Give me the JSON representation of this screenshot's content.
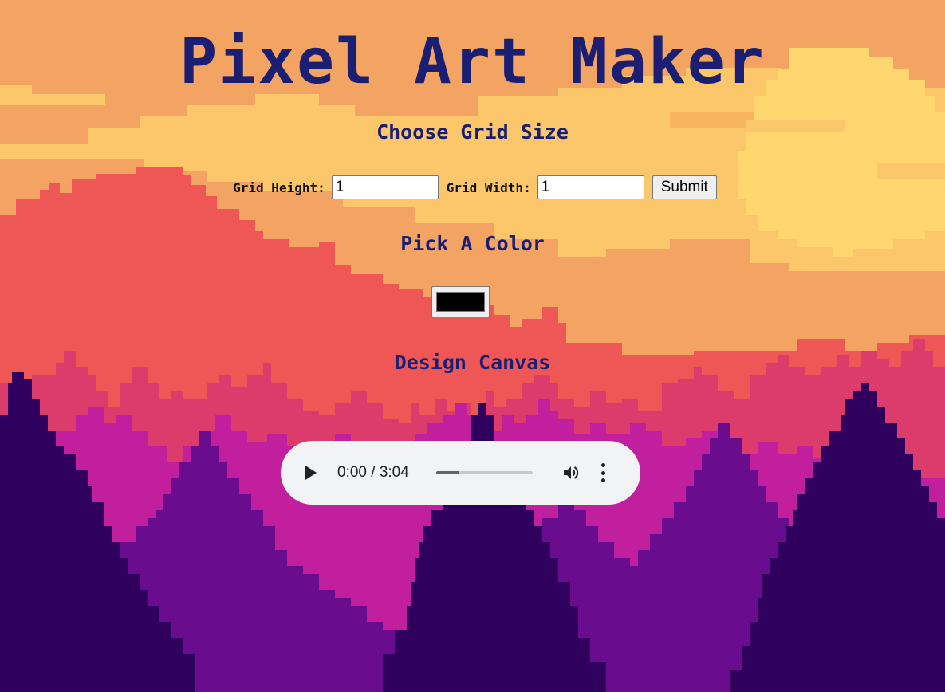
{
  "title": "Pixel Art Maker",
  "sections": {
    "grid_size_heading": "Choose Grid Size",
    "color_heading": "Pick A Color",
    "canvas_heading": "Design Canvas"
  },
  "form": {
    "height_label": "Grid Height:",
    "height_value": "1",
    "width_label": "Grid Width:",
    "width_value": "1",
    "submit_label": "Submit"
  },
  "color_picker": {
    "value": "#000000"
  },
  "audio": {
    "time": "0:00 / 3:04",
    "progress": 0.24,
    "icons": [
      "play-icon",
      "volume-icon",
      "more-options-icon"
    ]
  },
  "colors": {
    "heading": "#1b1f73",
    "sky": "#f4a462",
    "cloud": "#fbc76a",
    "sun": "#ffd76e",
    "mountain": "#ef5656",
    "far_trees": "#dc3c6c",
    "mid_trees": "#c21f9e",
    "purple_trees": "#6a0c8e",
    "dark_trees": "#30005f"
  }
}
